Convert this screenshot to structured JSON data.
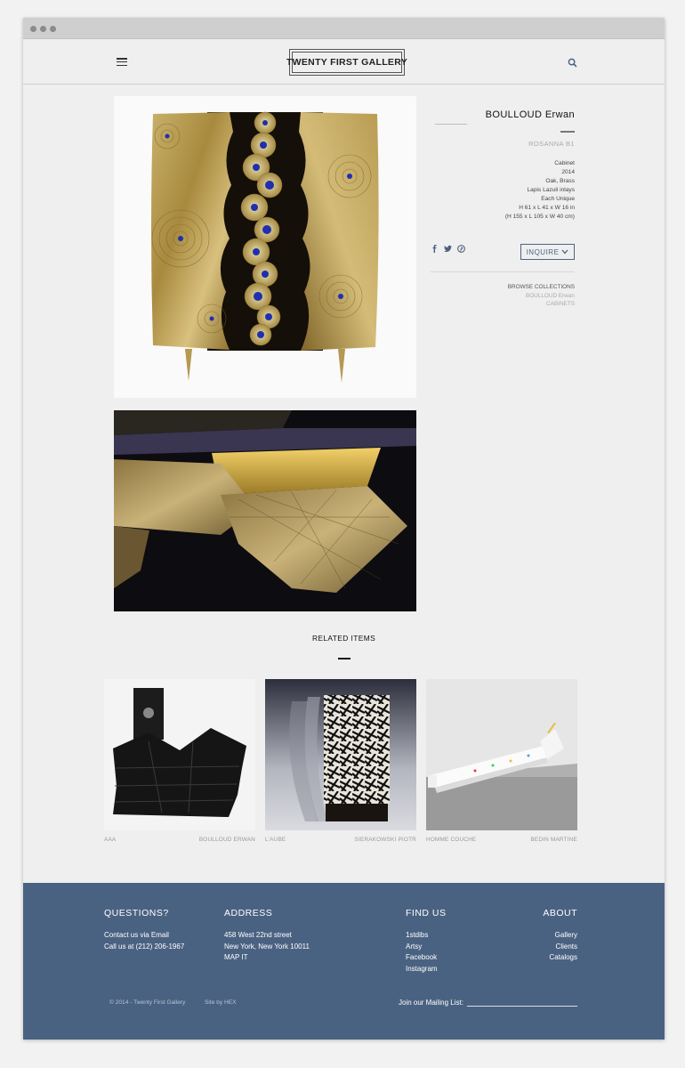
{
  "header": {
    "logo_text": "TWENTY FIRST GALLERY",
    "menu_icon": "hamburger-icon",
    "search_icon": "search-icon"
  },
  "product": {
    "artist": "BOULLOUD Erwan",
    "piece": "ROSANNA B1",
    "specs": [
      "Cabinet",
      "2014",
      "Oak, Brass",
      "Lapis Lazuli inlays",
      "Each Unique",
      "H 61 x L 41 x W 16 in",
      "(H 155 x L 105 x W 40 cm)"
    ],
    "inquire_label": "INQUIRE",
    "social_icons": [
      "facebook-icon",
      "twitter-icon",
      "pinterest-icon"
    ],
    "browse": {
      "title": "BROWSE COLLECTIONS",
      "artist": "BOULLOUD Erwan",
      "category": "CABINETS"
    }
  },
  "related": {
    "title": "RELATED ITEMS",
    "items": [
      {
        "name": "AAA",
        "artist": "BOULLOUD ERWAN"
      },
      {
        "name": "L'AUBE",
        "artist": "SIERAKOWSKI PIOTR"
      },
      {
        "name": "HOMME COUCHE",
        "artist": "BEDIN MARTINE"
      }
    ]
  },
  "footer": {
    "questions": {
      "title": "QUESTIONS?",
      "lines": [
        "Contact us via Email",
        "Call us at (212) 206-1967"
      ]
    },
    "address": {
      "title": "ADDRESS",
      "lines": [
        "458 West 22nd street",
        "New York, New York 10011",
        "MAP IT"
      ]
    },
    "find_us": {
      "title": "FIND US",
      "links": [
        "1stdibs",
        "Artsy",
        "Facebook",
        "Instagram"
      ]
    },
    "about": {
      "title": "ABOUT",
      "links": [
        "Gallery",
        "Clients",
        "Catalogs"
      ]
    },
    "copyright": "© 2014 - Twenty First Gallery",
    "site_by": "Site by HEX",
    "mailing_label": "Join our Mailing List:"
  },
  "colors": {
    "accent": "#4a6282",
    "background": "#efefef"
  }
}
